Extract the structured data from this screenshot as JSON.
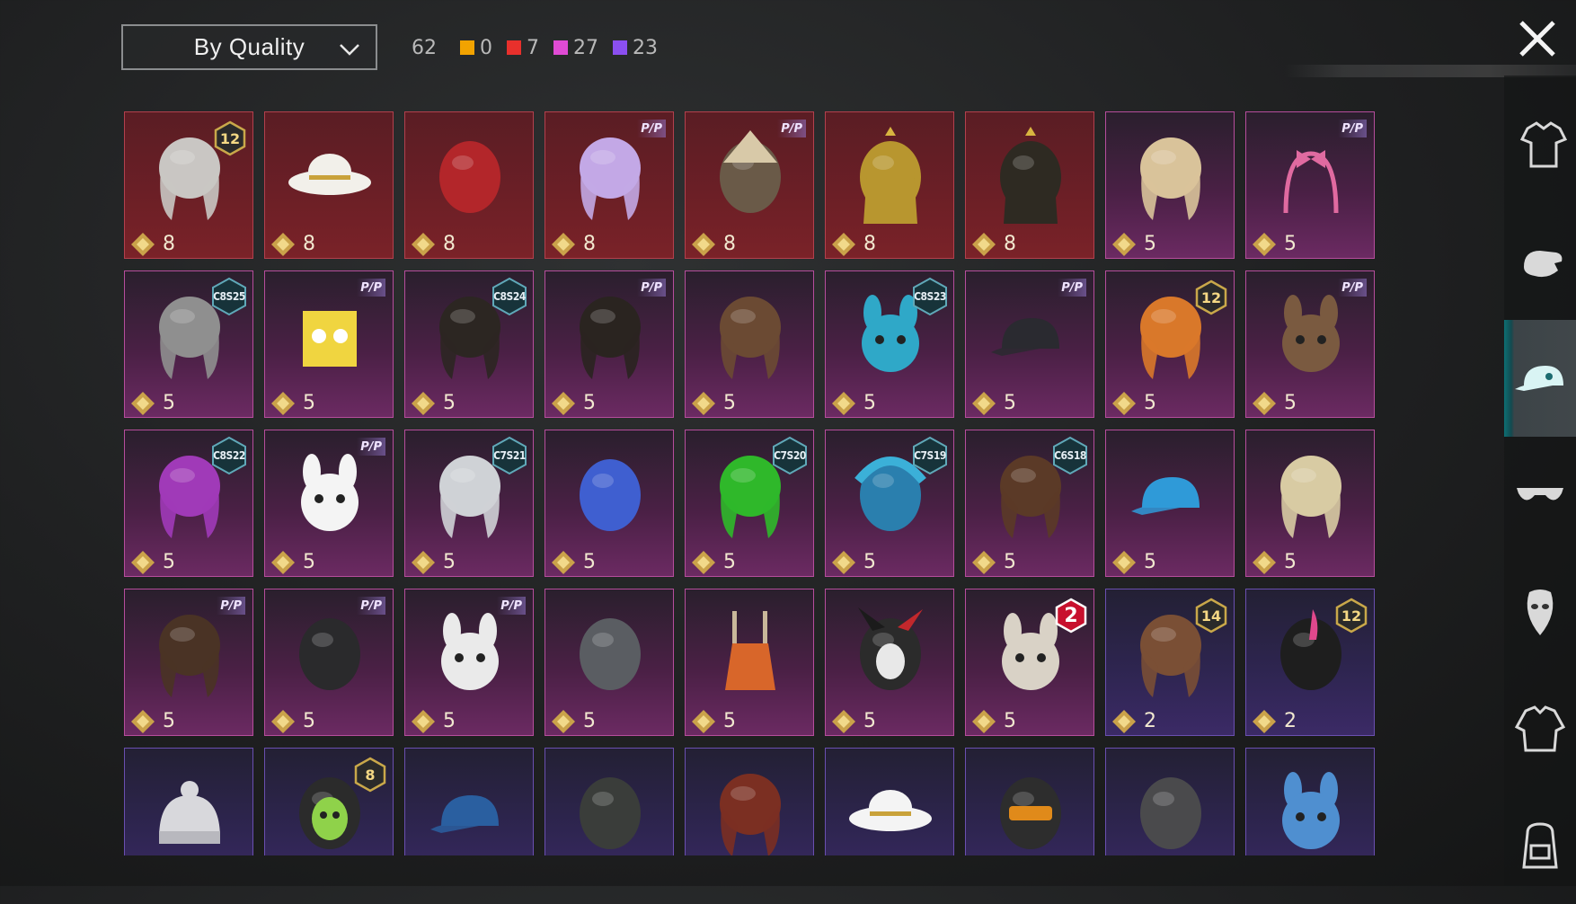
{
  "sort": {
    "label": "By Quality"
  },
  "counts": {
    "total": "62",
    "qualities": [
      {
        "color": "#f2a300",
        "value": "0"
      },
      {
        "color": "#e8302c",
        "value": "7"
      },
      {
        "color": "#e04bd4",
        "value": "27"
      },
      {
        "color": "#8b4ff0",
        "value": "23"
      }
    ]
  },
  "items": [
    {
      "tier": "red",
      "cost": "8",
      "badge": {
        "type": "level",
        "text": "12"
      },
      "icon": "silver-hair-icon"
    },
    {
      "tier": "red",
      "cost": "8",
      "badge": null,
      "icon": "white-cowboy-hat-icon"
    },
    {
      "tier": "red",
      "cost": "8",
      "badge": null,
      "icon": "red-helmet-icon"
    },
    {
      "tier": "red",
      "cost": "8",
      "badge": {
        "type": "pass",
        "text": "P/P"
      },
      "icon": "lavender-hair-icon"
    },
    {
      "tier": "red",
      "cost": "8",
      "badge": {
        "type": "pass",
        "text": "P/P"
      },
      "icon": "samurai-helmet-icon"
    },
    {
      "tier": "red",
      "cost": "8",
      "badge": null,
      "icon": "pharaoh-headdress-icon"
    },
    {
      "tier": "red",
      "cost": "8",
      "badge": null,
      "icon": "pharaoh-headdress-dark-icon"
    },
    {
      "tier": "pink",
      "cost": "5",
      "badge": null,
      "icon": "blonde-ponytail-icon"
    },
    {
      "tier": "pink",
      "cost": "5",
      "badge": {
        "type": "pass",
        "text": "P/P"
      },
      "icon": "bow-headband-icon"
    },
    {
      "tier": "pink",
      "cost": "5",
      "badge": {
        "type": "season",
        "text": "C8S25"
      },
      "icon": "gray-bob-hair-icon"
    },
    {
      "tier": "pink",
      "cost": "5",
      "badge": {
        "type": "pass",
        "text": "P/P"
      },
      "icon": "yellow-box-mask-icon"
    },
    {
      "tier": "pink",
      "cost": "5",
      "badge": {
        "type": "season",
        "text": "C8S24"
      },
      "icon": "dark-short-hair-icon"
    },
    {
      "tier": "pink",
      "cost": "5",
      "badge": {
        "type": "pass",
        "text": "P/P"
      },
      "icon": "dark-bun-hair-icon"
    },
    {
      "tier": "pink",
      "cost": "5",
      "badge": null,
      "icon": "brown-beret-hair-icon"
    },
    {
      "tier": "pink",
      "cost": "5",
      "badge": {
        "type": "season",
        "text": "C8S23"
      },
      "icon": "cat-headphones-hair-icon"
    },
    {
      "tier": "pink",
      "cost": "5",
      "badge": {
        "type": "pass",
        "text": "P/P"
      },
      "icon": "cap-sunglasses-icon"
    },
    {
      "tier": "pink",
      "cost": "5",
      "badge": {
        "type": "level",
        "text": "12"
      },
      "icon": "orange-twin-tails-icon"
    },
    {
      "tier": "pink",
      "cost": "5",
      "badge": {
        "type": "pass",
        "text": "P/P"
      },
      "icon": "bull-mask-icon"
    },
    {
      "tier": "pink",
      "cost": "5",
      "badge": {
        "type": "season",
        "text": "C8S22"
      },
      "icon": "purple-teal-hair-icon"
    },
    {
      "tier": "pink",
      "cost": "5",
      "badge": {
        "type": "pass",
        "text": "P/P"
      },
      "icon": "panda-mask-icon"
    },
    {
      "tier": "pink",
      "cost": "5",
      "badge": {
        "type": "season",
        "text": "C7S21"
      },
      "icon": "silver-swept-hair-icon"
    },
    {
      "tier": "pink",
      "cost": "5",
      "badge": null,
      "icon": "blue-dragon-headdress-icon"
    },
    {
      "tier": "pink",
      "cost": "5",
      "badge": {
        "type": "season",
        "text": "C7S20"
      },
      "icon": "green-hair-icon"
    },
    {
      "tier": "pink",
      "cost": "5",
      "badge": {
        "type": "season",
        "text": "C7S19"
      },
      "icon": "feather-headdress-icon"
    },
    {
      "tier": "pink",
      "cost": "5",
      "badge": {
        "type": "season",
        "text": "C6S18"
      },
      "icon": "brown-hair-icon"
    },
    {
      "tier": "pink",
      "cost": "5",
      "badge": null,
      "icon": "blue-cat-cap-icon"
    },
    {
      "tier": "pink",
      "cost": "5",
      "badge": null,
      "icon": "blonde-curls-hair-icon"
    },
    {
      "tier": "pink",
      "cost": "5",
      "badge": {
        "type": "pass",
        "text": "P/P"
      },
      "icon": "braided-hair-icon"
    },
    {
      "tier": "pink",
      "cost": "5",
      "badge": {
        "type": "pass",
        "text": "P/P"
      },
      "icon": "black-hood-mask-icon"
    },
    {
      "tier": "pink",
      "cost": "5",
      "badge": {
        "type": "pass",
        "text": "P/P"
      },
      "icon": "bunny-mask-icon"
    },
    {
      "tier": "pink",
      "cost": "5",
      "badge": null,
      "icon": "gray-helmet-icon"
    },
    {
      "tier": "pink",
      "cost": "5",
      "badge": null,
      "icon": "antler-hat-icon"
    },
    {
      "tier": "pink",
      "cost": "5",
      "badge": null,
      "icon": "jester-mask-icon"
    },
    {
      "tier": "pink",
      "cost": "5",
      "badge": {
        "type": "red",
        "text": "2"
      },
      "icon": "rabbit-head-icon"
    },
    {
      "tier": "purple",
      "cost": "2",
      "badge": {
        "type": "level",
        "text": "14"
      },
      "icon": "cap-long-hair-icon"
    },
    {
      "tier": "purple",
      "cost": "2",
      "badge": {
        "type": "level",
        "text": "12"
      },
      "icon": "pink-ear-helmet-icon"
    },
    {
      "tier": "purple",
      "cost": "",
      "badge": null,
      "icon": "beanie-icon"
    },
    {
      "tier": "purple",
      "cost": "",
      "badge": {
        "type": "level",
        "text": "8"
      },
      "icon": "green-skull-hood-icon"
    },
    {
      "tier": "purple",
      "cost": "",
      "badge": null,
      "icon": "baseball-cap-icon"
    },
    {
      "tier": "purple",
      "cost": "",
      "badge": null,
      "icon": "gas-mask-helmet-icon"
    },
    {
      "tier": "purple",
      "cost": "",
      "badge": null,
      "icon": "goggles-hair-icon"
    },
    {
      "tier": "purple",
      "cost": "",
      "badge": null,
      "icon": "sun-hat-icon"
    },
    {
      "tier": "purple",
      "cost": "",
      "badge": null,
      "icon": "orange-visor-helmet-icon"
    },
    {
      "tier": "purple",
      "cost": "",
      "badge": null,
      "icon": "black-mask-icon"
    },
    {
      "tier": "purple",
      "cost": "",
      "badge": null,
      "icon": "shark-hat-icon"
    }
  ],
  "categories": [
    {
      "icon": "outfit-icon",
      "active": false
    },
    {
      "icon": "glove-icon",
      "active": false
    },
    {
      "icon": "cap-icon",
      "active": true
    },
    {
      "icon": "sunglasses-icon",
      "active": false
    },
    {
      "icon": "mask-icon",
      "active": false
    },
    {
      "icon": "jacket-icon",
      "active": false
    },
    {
      "icon": "backpack-icon",
      "active": false
    }
  ]
}
